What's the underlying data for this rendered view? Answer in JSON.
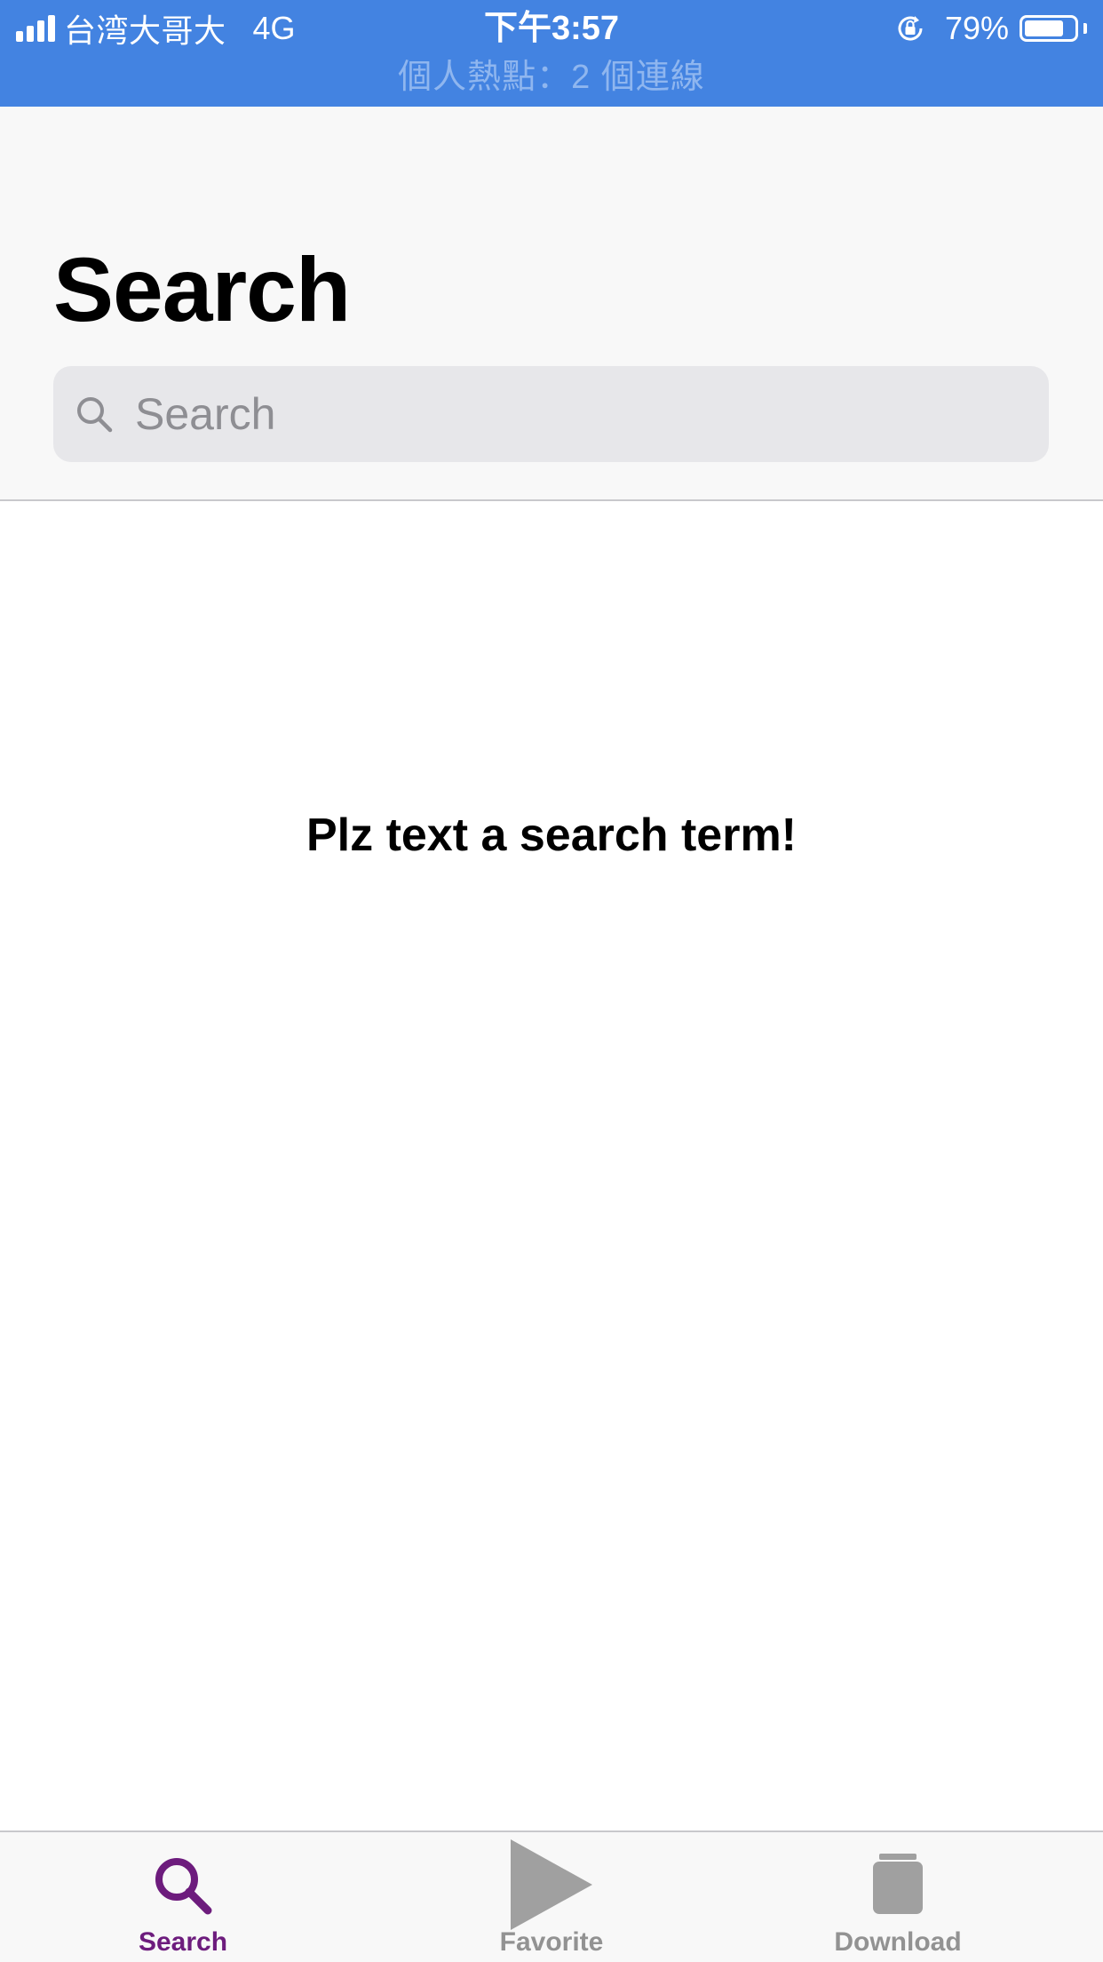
{
  "status_bar": {
    "carrier": "台湾大哥大",
    "network": "4G",
    "time": "下午3:57",
    "battery_percent": "79%",
    "battery_level": 0.79,
    "hotspot": "個人熱點：2 個連線",
    "background_color": "#4383e1"
  },
  "header": {
    "title": "Search",
    "search": {
      "placeholder": "Search",
      "value": ""
    }
  },
  "content": {
    "empty_message": "Plz text a search term!"
  },
  "tab_bar": {
    "active_color": "#6d1c7d",
    "inactive_color": "#929292",
    "tabs": [
      {
        "label": "Search",
        "icon": "magnifying-glass-icon",
        "active": true
      },
      {
        "label": "Favorite",
        "icon": "play-triangle-icon",
        "active": false
      },
      {
        "label": "Download",
        "icon": "jar-icon",
        "active": false
      }
    ]
  }
}
